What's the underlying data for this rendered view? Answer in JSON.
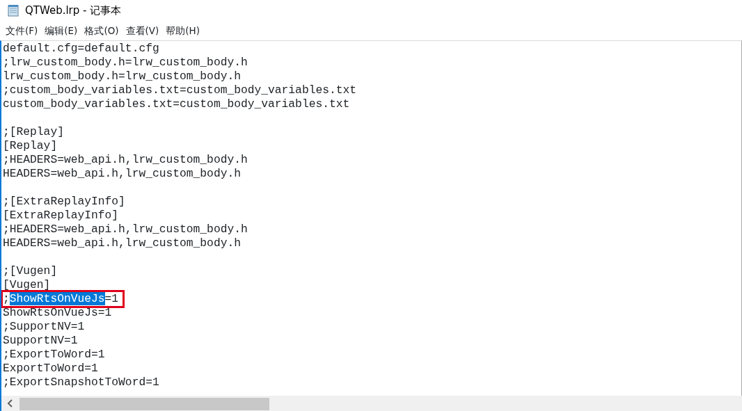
{
  "window": {
    "title": "QTWeb.lrp - 记事本"
  },
  "menu": [
    {
      "label": "文件(F)"
    },
    {
      "label": "编辑(E)"
    },
    {
      "label": "格式(O)"
    },
    {
      "label": "查看(V)"
    },
    {
      "label": "帮助(H)"
    }
  ],
  "lines": [
    {
      "kind": "plain",
      "text": "default.cfg=default.cfg"
    },
    {
      "kind": "plain",
      "text": ";lrw_custom_body.h=lrw_custom_body.h"
    },
    {
      "kind": "plain",
      "text": "lrw_custom_body.h=lrw_custom_body.h"
    },
    {
      "kind": "plain",
      "text": ";custom_body_variables.txt=custom_body_variables.txt"
    },
    {
      "kind": "plain",
      "text": "custom_body_variables.txt=custom_body_variables.txt"
    },
    {
      "kind": "blank"
    },
    {
      "kind": "plain",
      "text": ";[Replay]"
    },
    {
      "kind": "plain",
      "text": "[Replay]"
    },
    {
      "kind": "plain",
      "text": ";HEADERS=web_api.h,lrw_custom_body.h"
    },
    {
      "kind": "plain",
      "text": "HEADERS=web_api.h,lrw_custom_body.h"
    },
    {
      "kind": "blank"
    },
    {
      "kind": "plain",
      "text": ";[ExtraReplayInfo]"
    },
    {
      "kind": "plain",
      "text": "[ExtraReplayInfo]"
    },
    {
      "kind": "plain",
      "text": ";HEADERS=web_api.h,lrw_custom_body.h"
    },
    {
      "kind": "plain",
      "text": "HEADERS=web_api.h,lrw_custom_body.h"
    },
    {
      "kind": "blank"
    },
    {
      "kind": "plain",
      "text": ";[Vugen]"
    },
    {
      "kind": "plain",
      "text": "[Vugen]"
    },
    {
      "kind": "segmented",
      "outlined": true,
      "segments": [
        {
          "text": ";",
          "selected": false
        },
        {
          "text": "ShowRtsOnVueJs",
          "selected": true
        },
        {
          "text": "=1",
          "selected": false
        }
      ]
    },
    {
      "kind": "plain",
      "text": "ShowRtsOnVueJs=1"
    },
    {
      "kind": "plain",
      "text": ";SupportNV=1"
    },
    {
      "kind": "plain",
      "text": "SupportNV=1"
    },
    {
      "kind": "plain",
      "text": ";ExportToWord=1"
    },
    {
      "kind": "plain",
      "text": "ExportToWord=1"
    },
    {
      "kind": "plain",
      "text": ";ExportSnapshotToWord=1"
    }
  ]
}
